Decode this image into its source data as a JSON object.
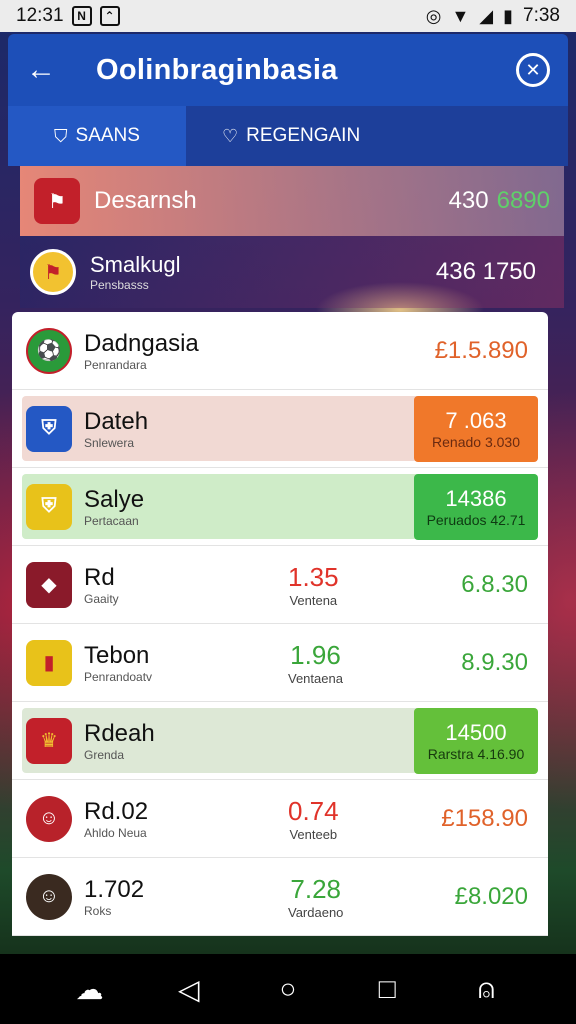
{
  "status_bar": {
    "time_left": "12:31",
    "time_right": "7:38"
  },
  "header": {
    "title": "Oolinbraginbasia"
  },
  "tabs": [
    {
      "label": "SAANS"
    },
    {
      "label": "REGENGAIN"
    }
  ],
  "top_rows": [
    {
      "name": "Desarnsh",
      "value_a": "430",
      "value_b": "6890"
    },
    {
      "name": "Smalkugl",
      "sub": "Pensbasss",
      "value": "436 1750"
    }
  ],
  "list": [
    {
      "name": "Dadngasia",
      "sub": "Penrandara",
      "right": "£1.5.890",
      "right_color": "#e0622a"
    },
    {
      "name": "Dateh",
      "sub": "Snlewera",
      "badge_top": "7 .063",
      "badge_bottom": "Renado 3.030",
      "badge_color": "#f0782a",
      "highlight": "#f1d9d3"
    },
    {
      "name": "Salye",
      "sub": "Pertacaan",
      "badge_top": "14386",
      "badge_bottom": "Peruados 42.71",
      "badge_color": "#3cb84a",
      "highlight": "#cfecc8"
    },
    {
      "name": "Rd",
      "sub": "Gaaity",
      "mid_num": "1.35",
      "mid_color": "#e0332a",
      "mid_label": "Ventena",
      "right": "6.8.30",
      "right_color": "#3aa63a"
    },
    {
      "name": "Tebon",
      "sub": "Penrandoatv",
      "mid_num": "1.96",
      "mid_color": "#3aa63a",
      "mid_label": "Ventaena",
      "right": "8.9.30",
      "right_color": "#3aa63a"
    },
    {
      "name": "Rdeah",
      "sub": "Grenda",
      "badge_top": "14500",
      "badge_bottom": "Rarstra 4.16.90",
      "badge_color": "#64c03a",
      "highlight": "#dde8d6"
    },
    {
      "name": "Rd.02",
      "sub": "Ahldo Neua",
      "mid_num": "0.74",
      "mid_color": "#e0332a",
      "mid_label": "Venteeb",
      "right": "£158.90",
      "right_color": "#e0622a"
    },
    {
      "name": "1.702",
      "sub": "Roks",
      "mid_num": "7.28",
      "mid_color": "#3aa63a",
      "mid_label": "Vardaeno",
      "right": "£8.020",
      "right_color": "#3aa63a"
    }
  ],
  "icons": {
    "back": "arrow-left-icon",
    "close": "close-circle-icon",
    "nav": [
      "assistant-icon",
      "back-triangle-icon",
      "home-circle-icon",
      "recents-square-icon",
      "account-icon"
    ]
  }
}
